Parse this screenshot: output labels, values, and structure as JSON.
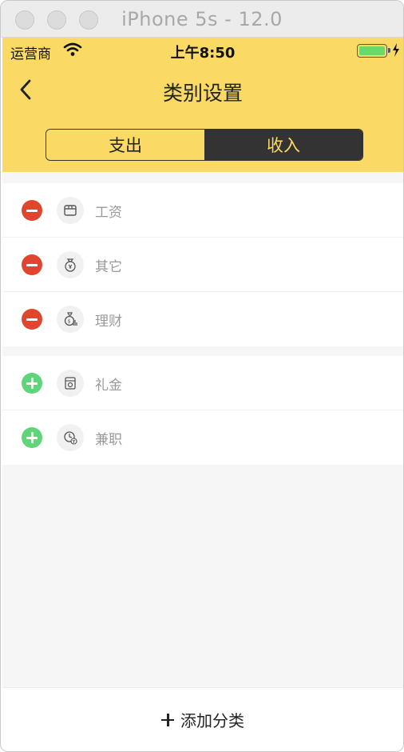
{
  "window": {
    "title": "iPhone 5s - 12.0"
  },
  "status_bar": {
    "carrier": "运营商",
    "time": "上午8:50"
  },
  "nav": {
    "title": "类别设置"
  },
  "segments": {
    "expense": "支出",
    "income": "收入",
    "selected": "收入"
  },
  "active_categories": [
    {
      "label": "工资",
      "icon": "wallet-icon",
      "action": "remove"
    },
    {
      "label": "其它",
      "icon": "money-bag-icon",
      "action": "remove"
    },
    {
      "label": "理财",
      "icon": "investment-icon",
      "action": "remove"
    }
  ],
  "available_categories": [
    {
      "label": "礼金",
      "icon": "gift-money-icon",
      "action": "add"
    },
    {
      "label": "兼职",
      "icon": "clock-yen-icon",
      "action": "add"
    }
  ],
  "footer": {
    "add_label": "添加分类"
  },
  "colors": {
    "brand_yellow": "#fad964",
    "remove_red": "#e2452f",
    "add_green": "#5fd57a",
    "segment_dark": "#333333"
  }
}
